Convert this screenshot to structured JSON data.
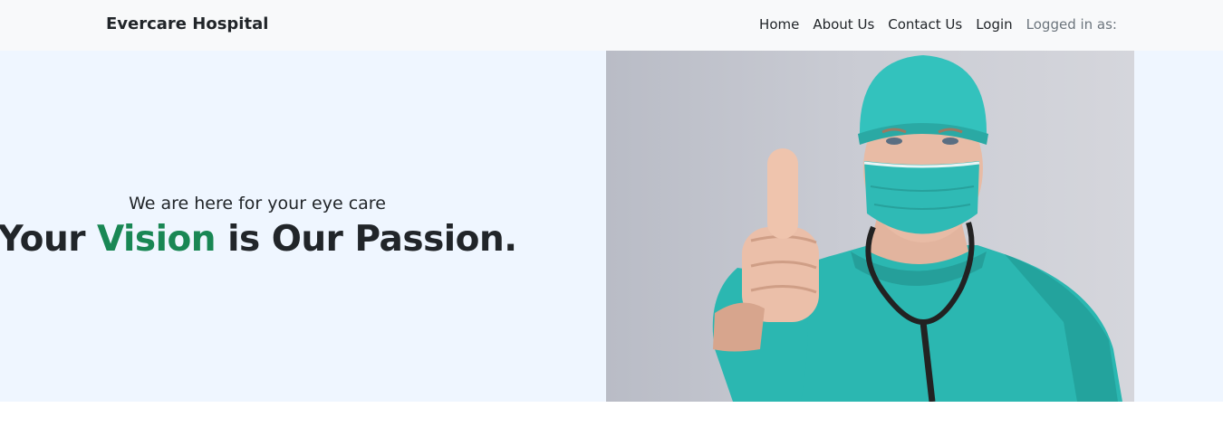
{
  "navbar": {
    "brand": "Evercare Hospital",
    "links": [
      {
        "label": "Home"
      },
      {
        "label": "About Us"
      },
      {
        "label": "Contact Us"
      },
      {
        "label": "Login"
      }
    ],
    "status_text": "Logged in as:"
  },
  "hero": {
    "subtitle": "We are here for your eye care",
    "headline_before": "Your ",
    "headline_accent": "Vision",
    "headline_after": " is Our Passion.",
    "image": "doctor-thumbs-up-photo",
    "accent_color": "#198754",
    "background_color": "#eff6ff"
  }
}
